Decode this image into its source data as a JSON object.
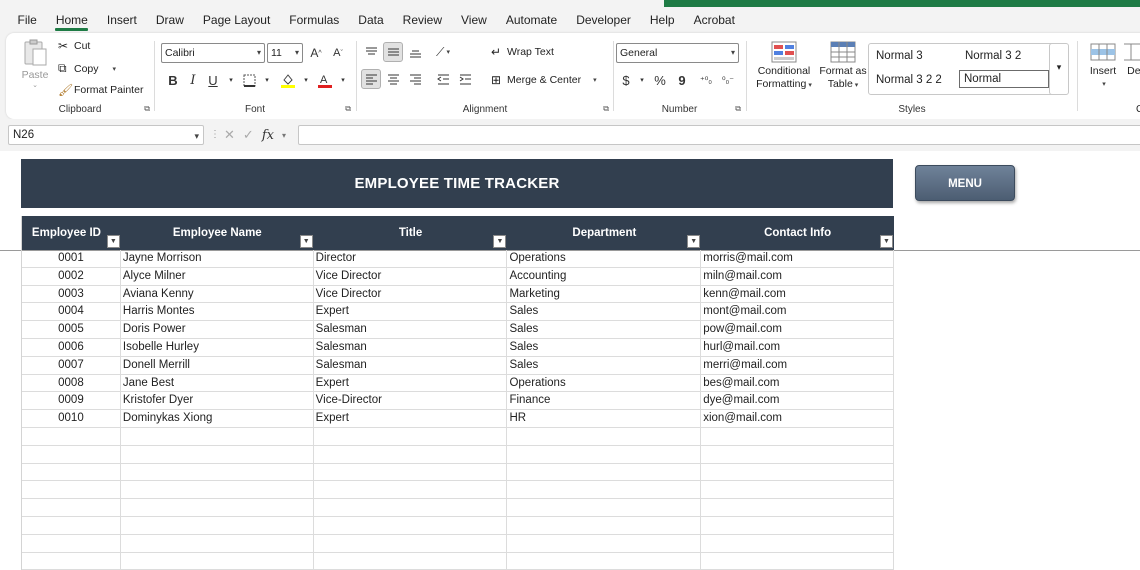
{
  "menu": {
    "tabs": [
      "File",
      "Home",
      "Insert",
      "Draw",
      "Page Layout",
      "Formulas",
      "Data",
      "Review",
      "View",
      "Automate",
      "Developer",
      "Help",
      "Acrobat"
    ],
    "active": "Home"
  },
  "ribbon": {
    "clipboard": {
      "paste": "Paste",
      "cut": "Cut",
      "copy": "Copy",
      "format_painter": "Format Painter",
      "label": "Clipboard"
    },
    "font": {
      "family": "Calibri",
      "size": "11",
      "bold": "B",
      "italic": "I",
      "underline": "U",
      "label": "Font"
    },
    "alignment": {
      "wrap_text": "Wrap Text",
      "merge_center": "Merge & Center",
      "label": "Alignment"
    },
    "number": {
      "format": "General",
      "currency": "$",
      "percent": "%",
      "comma": "9",
      "label": "Number"
    },
    "styles": {
      "conditional_formatting_1": "Conditional",
      "conditional_formatting_2": "Formatting",
      "format_as_table_1": "Format as",
      "format_as_table_2": "Table",
      "cells": [
        "Normal 3",
        "Normal 3 2",
        "Normal 3 2 2",
        "Normal"
      ],
      "label": "Styles"
    },
    "cells": {
      "insert": "Insert",
      "delete_partial": "Del",
      "label_partial": "Ce"
    }
  },
  "formula_bar": {
    "name_box": "N26",
    "fx": "fx",
    "value": ""
  },
  "sheet": {
    "title": "EMPLOYEE TIME TRACKER",
    "menu_button": "MENU",
    "columns": [
      "Employee ID",
      "Employee Name",
      "Title",
      "Department",
      "Contact Info"
    ],
    "rows": [
      [
        "0001",
        "Jayne Morrison",
        "Director",
        "Operations",
        "morris@mail.com"
      ],
      [
        "0002",
        "Alyce Milner",
        "Vice Director",
        "Accounting",
        "miln@mail.com"
      ],
      [
        "0003",
        "Aviana Kenny",
        "Vice Director",
        "Marketing",
        "kenn@mail.com"
      ],
      [
        "0004",
        "Harris Montes",
        "Expert",
        "Sales",
        "mont@mail.com"
      ],
      [
        "0005",
        "Doris Power",
        "Salesman",
        "Sales",
        "pow@mail.com"
      ],
      [
        "0006",
        "Isobelle Hurley",
        "Salesman",
        "Sales",
        "hurl@mail.com"
      ],
      [
        "0007",
        "Donell Merrill",
        "Salesman",
        "Sales",
        "merri@mail.com"
      ],
      [
        "0008",
        "Jane Best",
        "Expert",
        "Operations",
        "bes@mail.com"
      ],
      [
        "0009",
        "Kristofer Dyer",
        "Vice-Director",
        "Finance",
        "dye@mail.com"
      ],
      [
        "0010",
        "Dominykas Xiong",
        "Expert",
        "HR",
        "xion@mail.com"
      ],
      [
        "",
        "",
        "",
        "",
        ""
      ],
      [
        "",
        "",
        "",
        "",
        ""
      ],
      [
        "",
        "",
        "",
        "",
        ""
      ],
      [
        "",
        "",
        "",
        "",
        ""
      ],
      [
        "",
        "",
        "",
        "",
        ""
      ],
      [
        "",
        "",
        "",
        "",
        ""
      ],
      [
        "",
        "",
        "",
        "",
        ""
      ],
      [
        "",
        "",
        "",
        "",
        ""
      ],
      [
        "",
        "",
        "",
        "",
        ""
      ]
    ]
  },
  "colors": {
    "header_bg": "#323f4f",
    "accent_green": "#1e7b45",
    "menu_button": "#5b6d83"
  }
}
